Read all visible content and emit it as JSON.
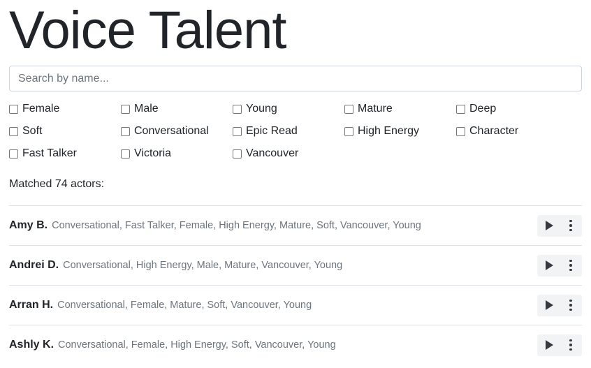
{
  "title": "Voice Talent",
  "search": {
    "placeholder": "Search by name...",
    "value": ""
  },
  "filters": [
    {
      "label": "Female",
      "checked": false
    },
    {
      "label": "Male",
      "checked": false
    },
    {
      "label": "Young",
      "checked": false
    },
    {
      "label": "Mature",
      "checked": false
    },
    {
      "label": "Deep",
      "checked": false
    },
    {
      "label": "Soft",
      "checked": false
    },
    {
      "label": "Conversational",
      "checked": false
    },
    {
      "label": "Epic Read",
      "checked": false
    },
    {
      "label": "High Energy",
      "checked": false
    },
    {
      "label": "Character",
      "checked": false
    },
    {
      "label": "Fast Talker",
      "checked": false
    },
    {
      "label": "Victoria",
      "checked": false
    },
    {
      "label": "Vancouver",
      "checked": false
    }
  ],
  "match_text": "Matched 74 actors:",
  "actors": [
    {
      "name": "Amy B.",
      "tags": "Conversational, Fast Talker, Female, High Energy, Mature, Soft, Vancouver, Young"
    },
    {
      "name": "Andrei D.",
      "tags": "Conversational, High Energy, Male, Mature, Vancouver, Young"
    },
    {
      "name": "Arran H.",
      "tags": "Conversational, Female, Mature, Soft, Vancouver, Young"
    },
    {
      "name": "Ashly K.",
      "tags": "Conversational, Female, High Energy, Soft, Vancouver, Young"
    }
  ],
  "icons": {
    "play": "play-icon",
    "more": "more-vertical-icon",
    "checkbox": "checkbox-icon"
  },
  "colors": {
    "text": "#212529",
    "muted": "#6c757d",
    "border": "#dee2e6",
    "action_bg": "#f1f3f5"
  }
}
